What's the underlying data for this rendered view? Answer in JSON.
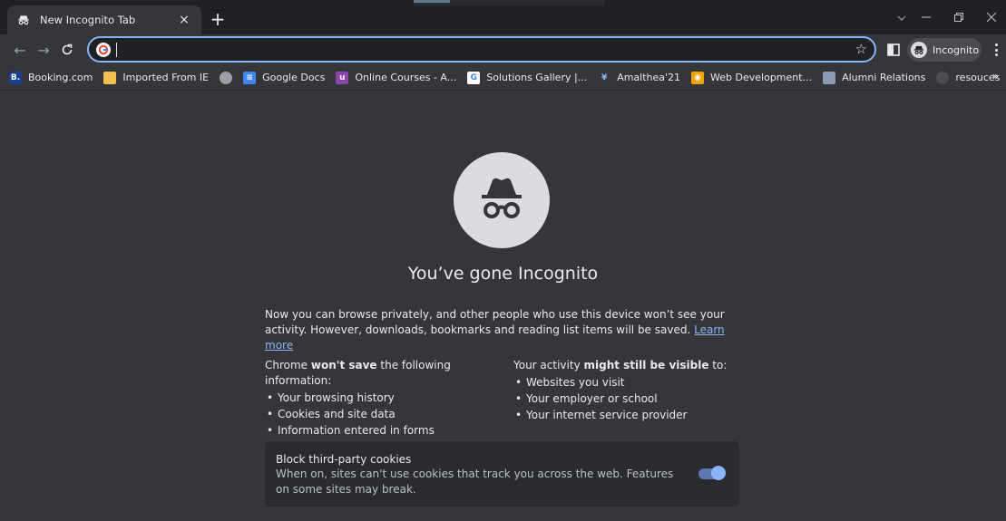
{
  "window": {
    "tab_title": "New Incognito Tab",
    "tab_close": "×",
    "new_tab": "+"
  },
  "toolbar": {
    "back": "←",
    "forward": "→",
    "reload": "C",
    "address_value": "",
    "star": "☆",
    "profile_label": "Incognito"
  },
  "bookmarks": [
    {
      "label": "Booking.com",
      "icon": "booking-icon",
      "color": "#1a3f94",
      "glyph": "B."
    },
    {
      "label": "Imported From IE",
      "icon": "folder-icon",
      "color": "#f2c04f",
      "glyph": ""
    },
    {
      "label": "",
      "icon": "globe-icon",
      "color": "#9aa0a6",
      "glyph": ""
    },
    {
      "label": "Google Docs",
      "icon": "docs-icon",
      "color": "#4285f4",
      "glyph": "≡"
    },
    {
      "label": "Online Courses - A...",
      "icon": "courses-icon",
      "color": "#8e44ad",
      "glyph": "u"
    },
    {
      "label": "Solutions Gallery |...",
      "icon": "google-icon",
      "color": "#ffffff",
      "glyph": "G"
    },
    {
      "label": "Amalthea'21",
      "icon": "amalthea-icon",
      "color": "#35363a",
      "glyph": "¥"
    },
    {
      "label": "Web Development...",
      "icon": "webdev-icon",
      "color": "#f0a500",
      "glyph": "◉"
    },
    {
      "label": "Alumni Relations",
      "icon": "alumni-icon",
      "color": "#8b9bb4",
      "glyph": ""
    },
    {
      "label": "resouces",
      "icon": "github-icon",
      "color": "#4a4c50",
      "glyph": ""
    }
  ],
  "bookmarks_more": "»",
  "page": {
    "headline": "You’ve gone Incognito",
    "intro_text": "Now you can browse privately, and other people who use this device won’t see your activity. However, downloads, bookmarks and reading list items will be saved.",
    "learn_more": "Learn more",
    "left_heading_pre": "Chrome ",
    "left_heading_bold": "won't save",
    "left_heading_post": " the following information:",
    "left_items": [
      "Your browsing history",
      "Cookies and site data",
      "Information entered in forms"
    ],
    "right_heading_pre": "Your activity ",
    "right_heading_bold": "might still be visible",
    "right_heading_post": " to:",
    "right_items": [
      "Websites you visit",
      "Your employer or school",
      "Your internet service provider"
    ]
  },
  "cookies": {
    "title": "Block third-party cookies",
    "description": "When on, sites can't use cookies that track you across the web. Features on some sites may break.",
    "enabled": true
  },
  "colors": {
    "background": "#35363a",
    "tabstrip": "#202124",
    "accent": "#8ab4f8"
  }
}
